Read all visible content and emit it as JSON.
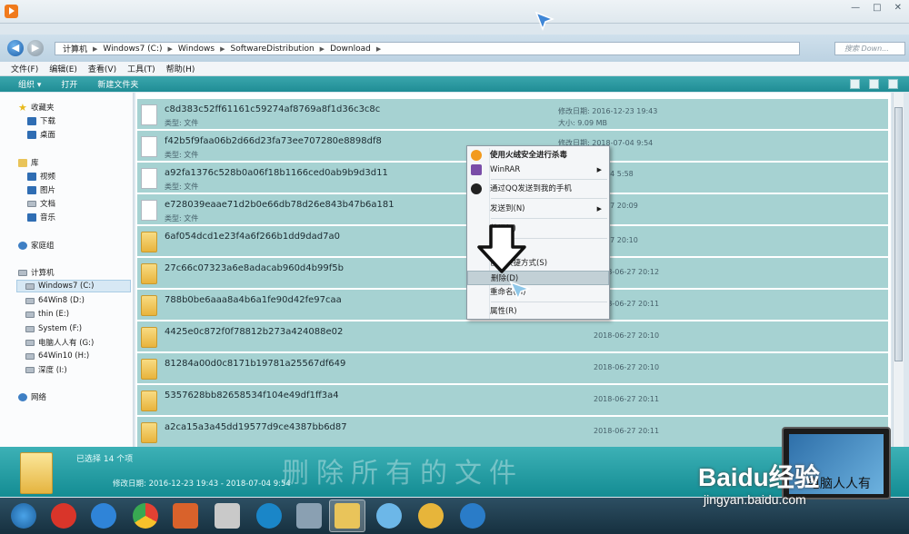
{
  "window_controls": {
    "minimize": "—",
    "maximize": "□",
    "close": "✕"
  },
  "address": {
    "crumbs": [
      "计算机",
      "Windows7 (C:)",
      "Windows",
      "SoftwareDistribution",
      "Download"
    ],
    "search_placeholder": "搜索 Down..."
  },
  "menu": [
    "文件(F)",
    "编辑(E)",
    "查看(V)",
    "工具(T)",
    "帮助(H)"
  ],
  "toolbar": {
    "organize": "组织 ▾",
    "open": "打开",
    "new_folder": "新建文件夹"
  },
  "nav": {
    "favorites": "收藏夹",
    "downloads": "下载",
    "desktop": "桌面",
    "libraries": "库",
    "videos": "视频",
    "pictures": "图片",
    "documents": "文档",
    "music": "音乐",
    "homegroup": "家庭组",
    "computer": "计算机",
    "drives": [
      "Windows7 (C:)",
      "64Win8 (D:)",
      "thin (E:)",
      "System (F:)",
      "电脑人人有 (G:)",
      "64Win10 (H:)",
      "深度 (I:)"
    ],
    "network": "网络"
  },
  "labels": {
    "modified": "修改日期:",
    "type": "类型:",
    "size": "大小:"
  },
  "files": [
    {
      "name": "c8d383c52ff61161c59274af8769a8f1d36c3c8c",
      "type": "文件",
      "date": "2016-12-23 19:43",
      "size": "9.09 MB"
    },
    {
      "name": "f42b5f9faa06b2d66d23fa73ee707280e8898df8",
      "type": "文件",
      "date": "2018-07-04 9:54"
    },
    {
      "name": "a92fa1376c528b0a06f18b1166ced0ab9b9d3d11",
      "type": "文件",
      "date": "01-24 5:58"
    },
    {
      "name": "e728039eaae71d2b0e66db78d26e843b47b6a181",
      "type": "文件",
      "date": "06-27 20:09"
    }
  ],
  "folders": [
    {
      "name": "6af054dcd1e23f4a6f266b1dd9dad7a0",
      "date": "06-27 20:10"
    },
    {
      "name": "27c66c07323a6e8adacab960d4b99f5b",
      "date": "2018-06-27 20:12"
    },
    {
      "name": "788b0be6aaa8a4b6a1fe90d42fe97caa",
      "date": "2018-06-27 20:11"
    },
    {
      "name": "4425e0c872f0f78812b273a424088e02",
      "date": "2018-06-27 20:10"
    },
    {
      "name": "81284a00d0c8171b19781a25567df649",
      "date": "2018-06-27 20:10"
    },
    {
      "name": "5357628bb82658534f104e49df1ff3a4",
      "date": "2018-06-27 20:11"
    },
    {
      "name": "a2ca15a3a45dd19577d9ce4387bb6d87",
      "date": "2018-06-27 20:11"
    }
  ],
  "context_menu": {
    "scan": "使用火绒安全进行杀毒",
    "winrar": "WinRAR",
    "qq": "通过QQ发送到我的手机",
    "sendto": "发送到(N)",
    "cut": "剪切(T)",
    "shortcut": "创建快捷方式(S)",
    "delete": "删除(D)",
    "rename": "重命名(M)",
    "properties": "属性(R)"
  },
  "details": {
    "selected": "已选择 14 个项",
    "date_label": "修改日期:",
    "date_range": "2016-12-23 19:43 - 2018-07-04 9:54",
    "watermark": "删除所有的文件"
  },
  "overlay": {
    "logo": "Baidu经验",
    "url": "jingyan.baidu.com",
    "screen_text": "电脑人人有"
  },
  "colors": {
    "selection": "#a6d2d2",
    "toolbar": "#2a9aa1",
    "details": "#27a1a7"
  }
}
